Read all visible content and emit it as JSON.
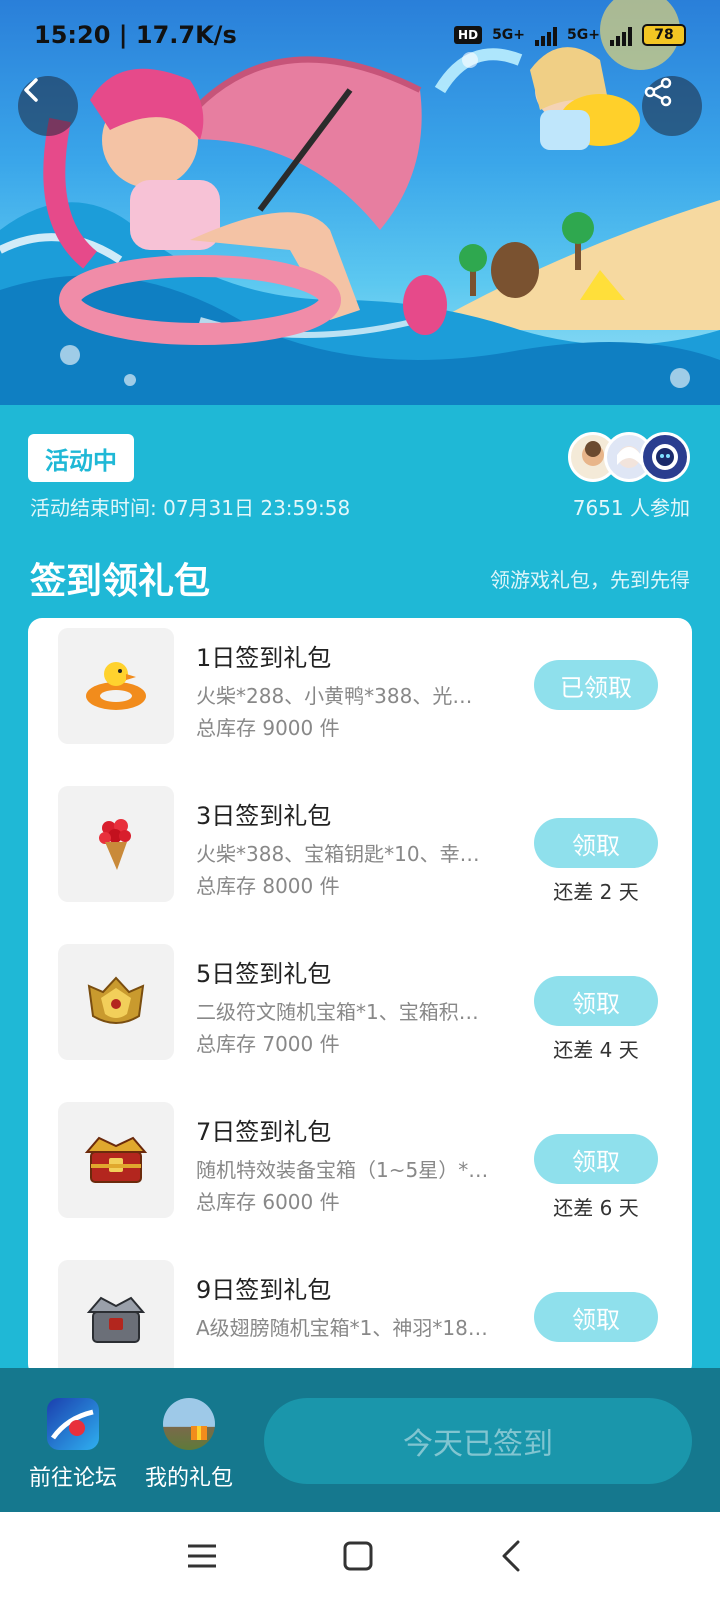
{
  "status_bar": {
    "time": "15:20 | 17.7K/s",
    "hd_label": "HD",
    "net1": "5G+",
    "net2": "5G+",
    "battery": "78"
  },
  "activity": {
    "badge": "活动中",
    "end_time": "活动结束时间: 07月31日 23:59:58",
    "participants": "7651 人参加"
  },
  "section": {
    "title": "签到领礼包",
    "subtitle": "领游戏礼包，先到先得"
  },
  "gifts": [
    {
      "name": "1日签到礼包",
      "desc": "火柴*288、小黄鸭*388、光…",
      "stock": "总库存 9000 件",
      "button": "已领取",
      "remain": ""
    },
    {
      "name": "3日签到礼包",
      "desc": "火柴*388、宝箱钥匙*10、幸…",
      "stock": "总库存 8000 件",
      "button": "领取",
      "remain": "还差 2 天"
    },
    {
      "name": "5日签到礼包",
      "desc": "二级符文随机宝箱*1、宝箱积…",
      "stock": "总库存 7000 件",
      "button": "领取",
      "remain": "还差 4 天"
    },
    {
      "name": "7日签到礼包",
      "desc": "随机特效装备宝箱（1~5星）*…",
      "stock": "总库存 6000 件",
      "button": "领取",
      "remain": "还差 6 天"
    },
    {
      "name": "9日签到礼包",
      "desc": "A级翅膀随机宝箱*1、神羽*18…",
      "stock": "",
      "button": "领取",
      "remain": ""
    }
  ],
  "bottom": {
    "forum_label": "前往论坛",
    "mygift_label": "我的礼包",
    "checkin_label": "今天已签到"
  },
  "colors": {
    "page_bg": "#1fb8d6",
    "button_bg": "#8fe0ec",
    "bottom_bar": "#15788e"
  }
}
